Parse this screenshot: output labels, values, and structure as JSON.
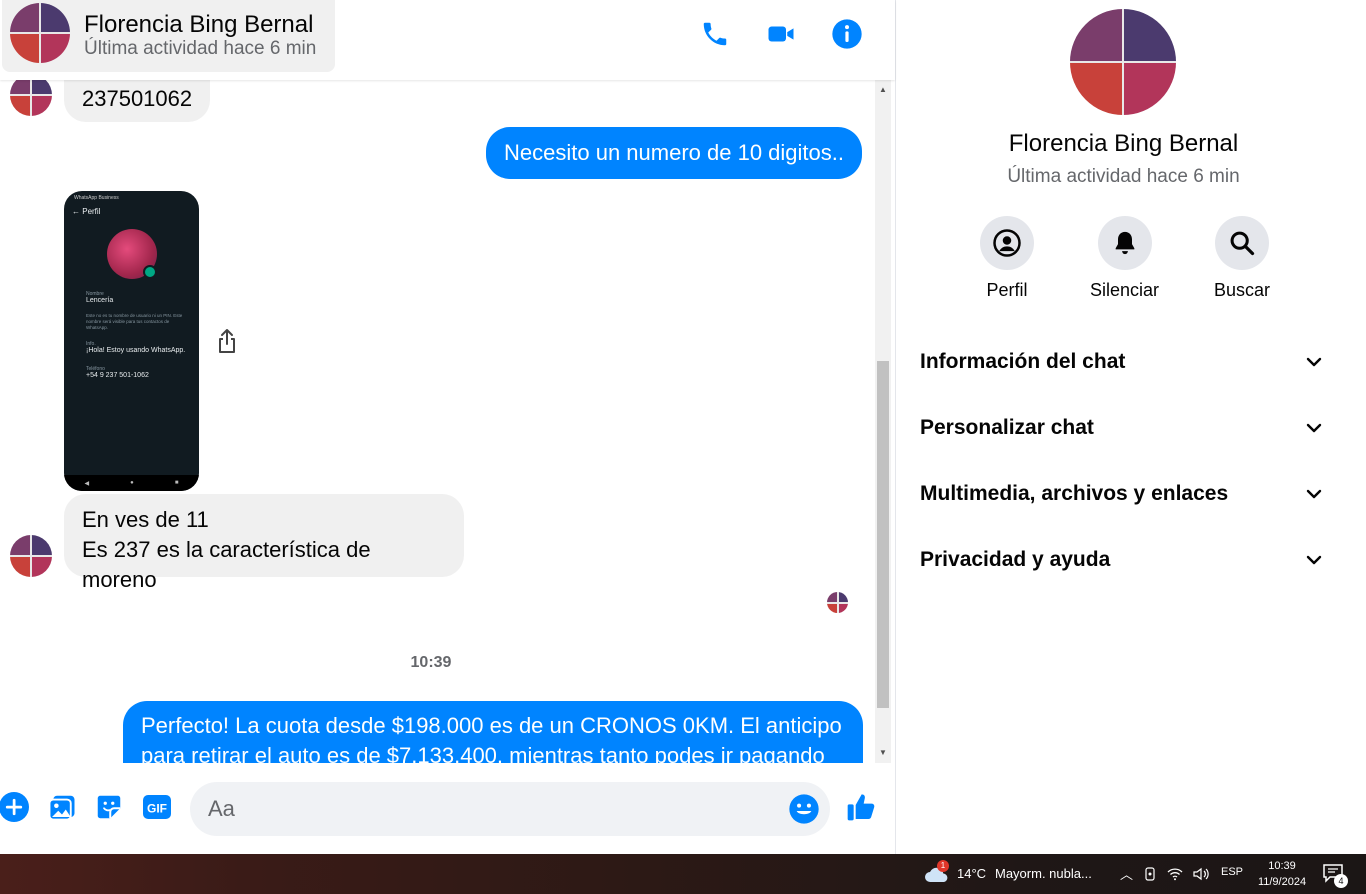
{
  "colors": {
    "accent": "#0084ff",
    "bubble_in": "#f0f0f0",
    "muted_text": "#65676b"
  },
  "contact": {
    "name": "Florencia Bing Bernal",
    "status": "Última actividad hace 6 min"
  },
  "header_actions": [
    {
      "icon": "phone-icon"
    },
    {
      "icon": "video-camera-icon"
    },
    {
      "icon": "info-icon"
    }
  ],
  "messages": {
    "partial_top": "237501062",
    "out_1": "Necesito un numero de 10 digitos..",
    "screenshot": {
      "app_bar": "WhatsApp Business",
      "title": "Perfil",
      "name_label": "Nombre",
      "name_value": "Lencería",
      "name_note": "Este no es tu nombre de usuario ni un PIN. Este nombre será visible para tus contactos de WhatsApp.",
      "info_label": "Info.",
      "info_value": "¡Hola! Estoy usando WhatsApp.",
      "phone_label": "Teléfono",
      "phone_value": "+54 9 237 501-1062"
    },
    "in_2_line1": "En ves de 11",
    "in_2_line2": "Es 237 es la característica de moreno",
    "time_separator": "10:39",
    "out_2": "Perfecto! La cuota desde $198.000 es de un CRONOS 0KM. El anticipo para retirar el auto es de $7.133.400, mientras tanto podes ir pagando"
  },
  "composer": {
    "placeholder": "Aa",
    "icons": [
      "plus-icon",
      "photo-icon",
      "sticker-icon",
      "gif-icon",
      "emoji-icon",
      "thumbs-up-icon"
    ],
    "gif_label": "GIF"
  },
  "info_panel": {
    "name": "Florencia Bing Bernal",
    "status": "Última actividad hace 6 min",
    "actions": [
      {
        "label": "Perfil",
        "icon": "profile-icon"
      },
      {
        "label": "Silenciar",
        "icon": "bell-icon"
      },
      {
        "label": "Buscar",
        "icon": "search-icon"
      }
    ],
    "sections": [
      "Información del chat",
      "Personalizar chat",
      "Multimedia, archivos y enlaces",
      "Privacidad y ayuda"
    ]
  },
  "taskbar": {
    "weather_temp": "14°C",
    "weather_text": "Mayorm. nubla...",
    "weather_badge": "1",
    "language": "ESP",
    "time": "10:39",
    "date": "11/9/2024",
    "notification_count": "4"
  }
}
